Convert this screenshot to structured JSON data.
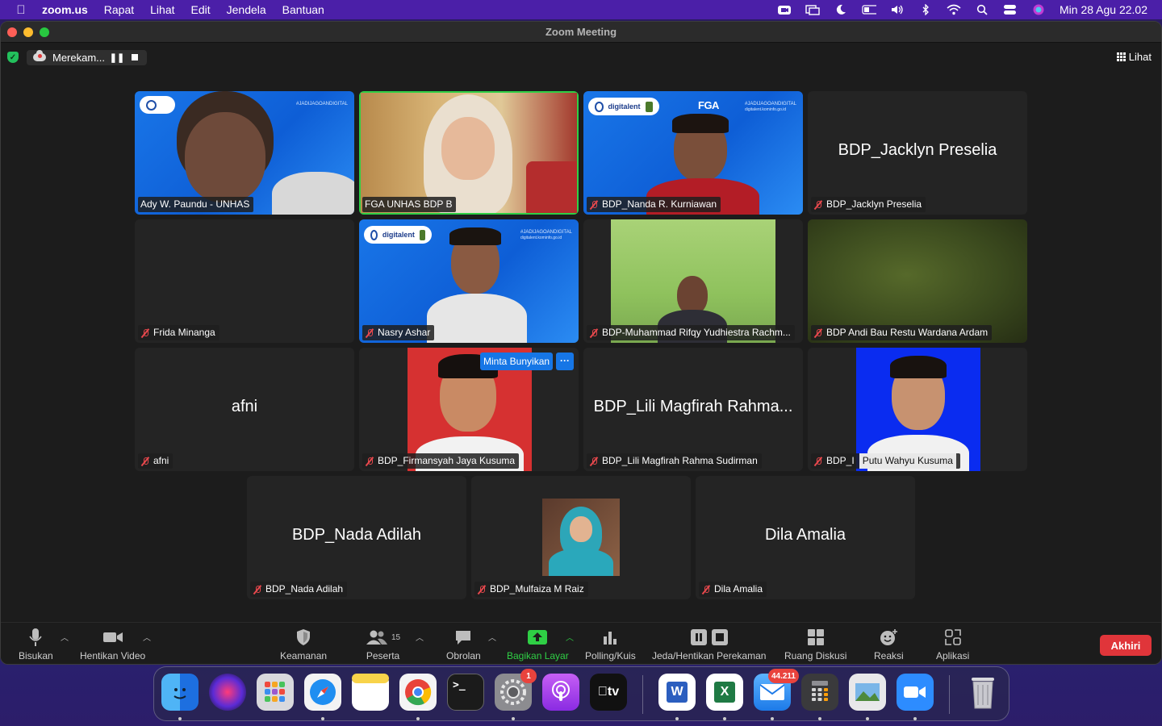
{
  "menubar": {
    "app_name": "zoom.us",
    "items": [
      "Rapat",
      "Lihat",
      "Edit",
      "Jendela",
      "Bantuan"
    ],
    "clock": "Min 28 Agu  22.02"
  },
  "window": {
    "title": "Zoom Meeting"
  },
  "recording": {
    "status": "Merekam...",
    "view_label": "Lihat"
  },
  "tiles": [
    {
      "label": "Ady W. Paundu - UNHAS"
    },
    {
      "label": "FGA UNHAS BDP B"
    },
    {
      "label": "BDP_Nanda R. Kurniawan"
    },
    {
      "label": "BDP_Jacklyn Preselia",
      "big_name": "BDP_Jacklyn Preselia"
    },
    {
      "label": "Frida Minanga"
    },
    {
      "label": "Nasry Ashar"
    },
    {
      "label": "BDP-Muhammad Rifqy Yudhiestra Rachm..."
    },
    {
      "label": "BDP Andi Bau Restu Wardana Ardam"
    },
    {
      "label": "afni",
      "big_name": "afni"
    },
    {
      "label": "BDP_Firmansyah Jaya Kusuma",
      "tooltip": "Minta Bunyikan",
      "more": "···"
    },
    {
      "label": "BDP_Lili Magfirah Rahma Sudirman",
      "big_name": "BDP_Lili Magfirah Rahma..."
    },
    {
      "label": "BDP_I",
      "label_overlay": "Putu Wahyu Kusuma"
    },
    {
      "label": "BDP_Nada Adilah",
      "big_name": "BDP_Nada Adilah"
    },
    {
      "label": "BDP_Mulfaiza M Raiz"
    },
    {
      "label": "Dila Amalia",
      "big_name": "Dila Amalia"
    }
  ],
  "video_overlays": {
    "hashtag": "#JADIJAGOANDIGITAL",
    "site": "digitalent.kominfo.go.id",
    "fga": "FGA",
    "brand": "digitalent"
  },
  "toolbar": {
    "mute": "Bisukan",
    "video": "Hentikan Video",
    "security": "Keamanan",
    "participants": "Peserta",
    "participants_count": "15",
    "chat": "Obrolan",
    "share": "Bagikan Layar",
    "polls": "Polling/Kuis",
    "record": "Jeda/Hentikan Perekaman",
    "breakout": "Ruang Diskusi",
    "reactions": "Reaksi",
    "apps": "Aplikasi",
    "end": "Akhiri"
  },
  "dock": {
    "apps": [
      "Finder",
      "Siri",
      "Launchpad",
      "Safari",
      "Notes",
      "Chrome",
      "Terminal",
      "System Settings",
      "Podcasts",
      "Apple TV",
      "Word",
      "Excel",
      "Mail",
      "Calculator",
      "Preview",
      "Zoom",
      "Trash"
    ],
    "settings_badge": "1",
    "mail_badge": "44.211",
    "tv_label": "tv",
    "terminal_prompt": ">_",
    "word_letter": "W",
    "excel_letter": "X"
  },
  "colors": {
    "active_speaker": "#2fcf45",
    "muted_mic": "#e8484d",
    "end_button": "#e0353a",
    "menubar": "#4b1fa8",
    "tile_bg": "#242424"
  }
}
